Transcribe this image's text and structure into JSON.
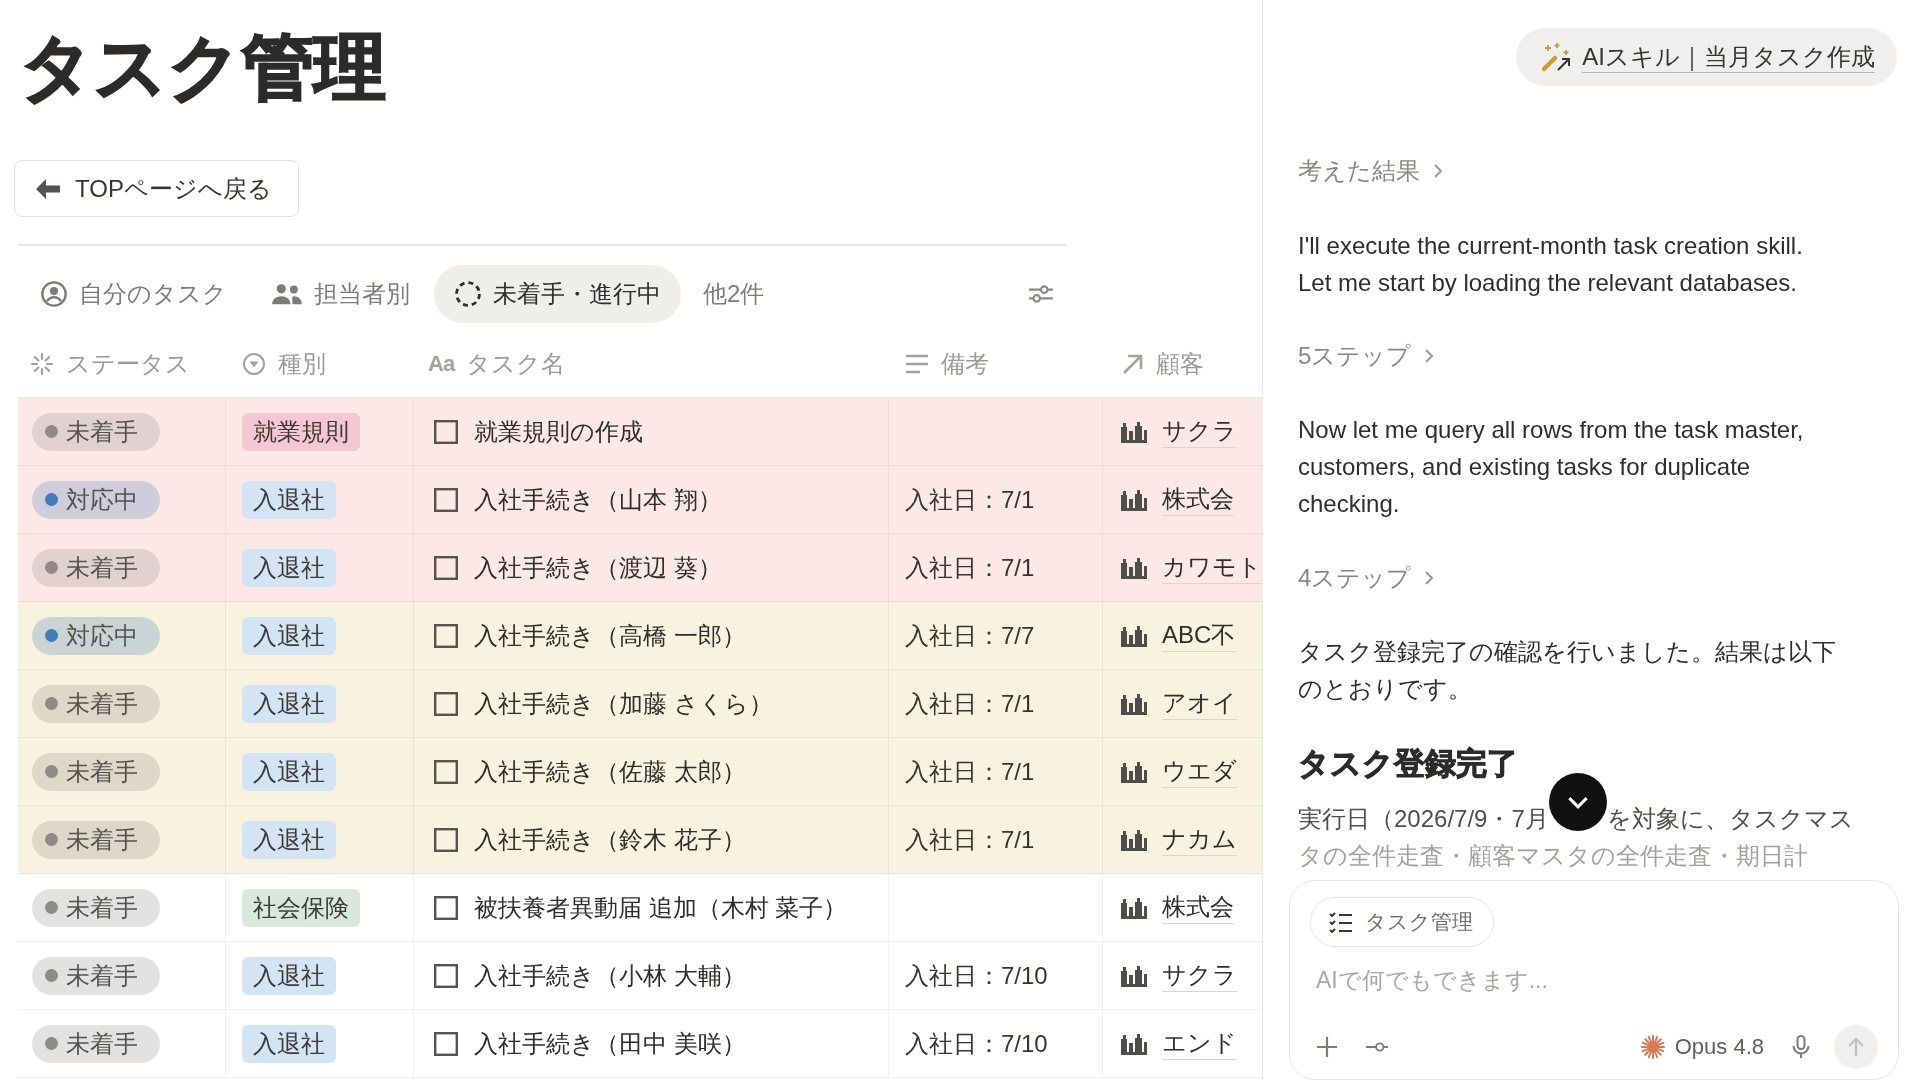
{
  "page": {
    "title": "タスク管理",
    "back_button": "TOPページへ戻る"
  },
  "views": {
    "tabs": [
      {
        "label": "自分のタスク",
        "selected": false
      },
      {
        "label": "担当者別",
        "selected": false
      },
      {
        "label": "未着手・進行中",
        "selected": true
      }
    ],
    "more": "他2件"
  },
  "table": {
    "columns": [
      {
        "label": "ステータス",
        "kind": "status"
      },
      {
        "label": "種別",
        "kind": "select"
      },
      {
        "label": "タスク名",
        "kind": "title",
        "icon_text": "Aa"
      },
      {
        "label": "備考",
        "kind": "text"
      },
      {
        "label": "顧客",
        "kind": "relation"
      }
    ],
    "rows": [
      {
        "color": "#fde8e8",
        "status": {
          "label": "未着手",
          "color": "#8f8b86"
        },
        "type": {
          "label": "就業規則",
          "color": "#f5c6d5"
        },
        "task": {
          "title": "就業規則の作成",
          "checked": false
        },
        "customer": "サクラ"
      },
      {
        "color": "#fde8e8",
        "status": {
          "label": "対応中",
          "color": "#447bb5"
        },
        "type": {
          "label": "入退社",
          "color": "#d3e5f5"
        },
        "task": {
          "title": "入社手続き（山本 翔）",
          "checked": false
        },
        "note": "入社日：7/1",
        "customer": "株式会"
      },
      {
        "color": "#fde8e8",
        "status": {
          "label": "未着手",
          "color": "#8f8b86"
        },
        "type": {
          "label": "入退社",
          "color": "#d3e5f5"
        },
        "task": {
          "title": "入社手続き（渡辺 葵）",
          "checked": false
        },
        "note": "入社日：7/1",
        "customer": "カワモト"
      },
      {
        "color": "#f9f2df",
        "status": {
          "label": "対応中",
          "color": "#447bb5"
        },
        "type": {
          "label": "入退社",
          "color": "#d3e5f5"
        },
        "task": {
          "title": "入社手続き（高橋 一郎）",
          "checked": false
        },
        "note": "入社日：7/7",
        "customer": "ABC不"
      },
      {
        "color": "#f9f2df",
        "status": {
          "label": "未着手",
          "color": "#8f8b86"
        },
        "type": {
          "label": "入退社",
          "color": "#d3e5f5"
        },
        "task": {
          "title": "入社手続き（加藤 さくら）",
          "checked": false
        },
        "note": "入社日：7/1",
        "customer": "アオイ"
      },
      {
        "color": "#f9f2df",
        "status": {
          "label": "未着手",
          "color": "#8f8b86"
        },
        "type": {
          "label": "入退社",
          "color": "#d3e5f5"
        },
        "task": {
          "title": "入社手続き（佐藤 太郎）",
          "checked": false
        },
        "note": "入社日：7/1",
        "customer": "ウエダ"
      },
      {
        "color": "#f9f2df",
        "status": {
          "label": "未着手",
          "color": "#8f8b86"
        },
        "type": {
          "label": "入退社",
          "color": "#d3e5f5"
        },
        "task": {
          "title": "入社手続き（鈴木 花子）",
          "checked": false
        },
        "note": "入社日：7/1",
        "customer": "ナカム"
      },
      {
        "color": "#ffffff",
        "status": {
          "label": "未着手",
          "color": "#8f8b86"
        },
        "type": {
          "label": "社会保険",
          "color": "#d8e8df"
        },
        "task": {
          "title": "被扶養者異動届 追加（木村 菜子）",
          "checked": false
        },
        "customer": "株式会"
      },
      {
        "color": "#ffffff",
        "status": {
          "label": "未着手",
          "color": "#8f8b86"
        },
        "type": {
          "label": "入退社",
          "color": "#d3e5f5"
        },
        "task": {
          "title": "入社手続き（小林 大輔）",
          "checked": false
        },
        "note": "入社日：7/10",
        "customer": "サクラ"
      },
      {
        "color": "#ffffff",
        "status": {
          "label": "未着手",
          "color": "#8f8b86"
        },
        "type": {
          "label": "入退社",
          "color": "#d3e5f5"
        },
        "task": {
          "title": "入社手続き（田中 美咲）",
          "checked": false
        },
        "note": "入社日：7/10",
        "customer": "エンド"
      }
    ]
  },
  "assistant": {
    "skill_chip": "AIスキル｜当月タスク作成",
    "blocks": [
      {
        "kind": "toggle",
        "label": "考えた結果",
        "expanded": false
      },
      {
        "kind": "text",
        "text": "I'll execute the current-month task creation skill. Let me start by loading the relevant databases."
      },
      {
        "kind": "toggle",
        "label": "5ステップ",
        "expanded": false
      },
      {
        "kind": "text",
        "text": "Now let me query all rows from the task master, customers, and existing tasks for duplicate checking."
      },
      {
        "kind": "toggle",
        "label": "4ステップ",
        "expanded": false
      },
      {
        "kind": "text",
        "text": "タスク登録完了の確認を行いました。結果は以下のとおりです。"
      },
      {
        "kind": "heading",
        "text": "タスク登録完了"
      },
      {
        "kind": "covered",
        "parts": [
          "実行日（2026/7/9・7月",
          "を対象に、タスクマス"
        ]
      },
      {
        "kind": "faded",
        "text": "タの全件走査・顧客マスタの全件走査・期日計"
      }
    ],
    "composer": {
      "context_chip": "タスク管理",
      "placeholder": "AIで何でもできます...",
      "model": "Opus 4.8"
    }
  }
}
